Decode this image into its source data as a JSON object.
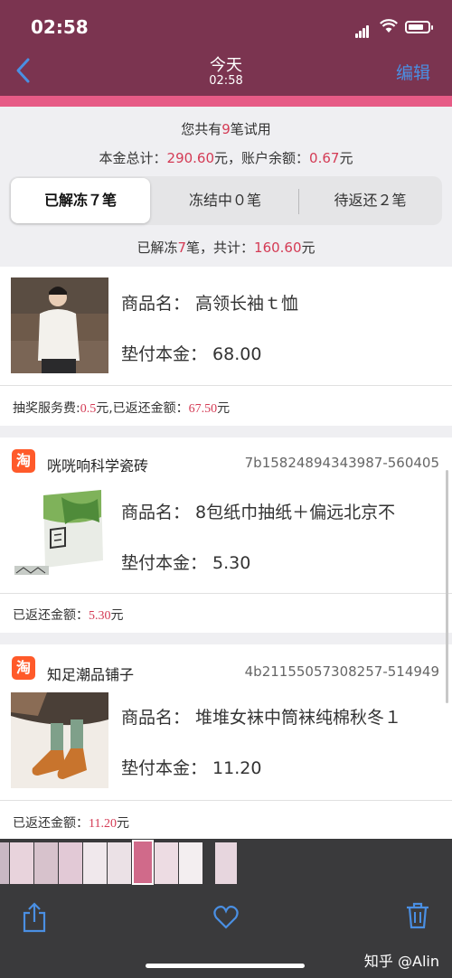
{
  "status": {
    "time": "02:58"
  },
  "nav": {
    "title": "今天",
    "subtitle": "02:58",
    "edit_label": "编辑"
  },
  "summary": {
    "line1_pre": "您共有",
    "line1_count": "9",
    "line1_post": "笔试用",
    "line2_principal_label": "本金总计：",
    "line2_principal_value": "290.60",
    "line2_mid": "元，账户余额：",
    "line2_balance_value": "0.67",
    "line2_post": "元",
    "line3_pre": "已解冻",
    "line3_count": "7",
    "line3_mid": "笔，共计：",
    "line3_value": "160.60",
    "line3_post": "元"
  },
  "tabs": [
    {
      "label": "已解冻７笔",
      "active": true
    },
    {
      "label": "冻结中０笔",
      "active": false
    },
    {
      "label": "待返还２笔",
      "active": false
    }
  ],
  "cards": [
    {
      "name": "商品名：  高领长袖ｔ恤",
      "price": "垫付本金：  68.00",
      "footer_label": "抽奖服务费:",
      "footer_fee": "0.5",
      "footer_mid": "元,已返还金额：",
      "footer_amount": "67.50",
      "footer_unit": "元"
    },
    {
      "shop_icon": "淘",
      "shop": "咣咣响科学瓷砖",
      "order_id": "7b15824894343987-560405",
      "name": "商品名：  8包纸巾抽纸＋偏远北京不",
      "price": "垫付本金：  5.30",
      "footer_label": "已返还金额：",
      "footer_amount": "5.30",
      "footer_unit": "元"
    },
    {
      "shop_icon": "淘",
      "shop": "知足潮品铺子",
      "order_id": "4b21155057308257-514949",
      "name": "商品名：  堆堆女袜中筒袜纯棉秋冬１",
      "price": "垫付本金：  11.20",
      "footer_label": "已返还金额：",
      "footer_amount": "11.20",
      "footer_unit": "元"
    }
  ],
  "watermark": "知乎 @Alin",
  "colors": {
    "header": "#7b3450",
    "accent_pink": "#e65b86",
    "amount_red": "#d43b55",
    "ios_blue": "#4a8fe3"
  },
  "icons": [
    "back-icon",
    "share-icon",
    "heart-icon",
    "trash-icon",
    "taobao-icon"
  ]
}
